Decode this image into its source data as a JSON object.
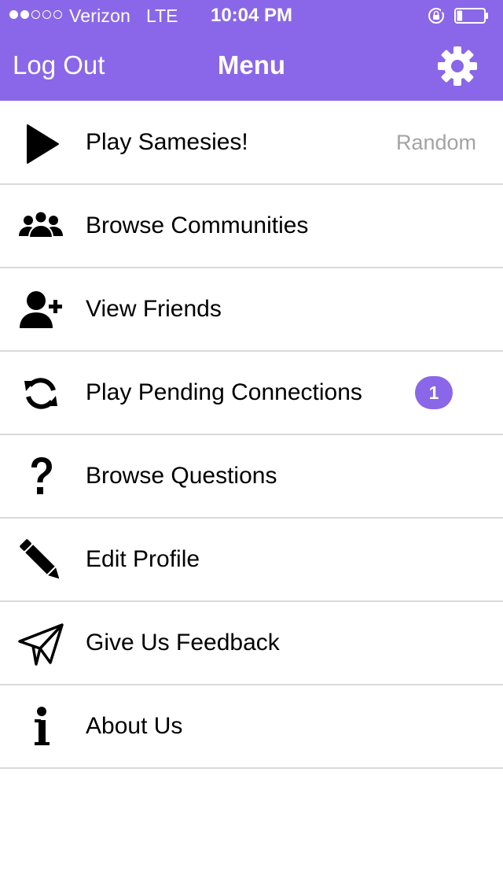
{
  "colors": {
    "accent": "#8a67e8",
    "background": "#ffffff",
    "divider": "#d9d9d9",
    "detail_text": "#a3a3a3"
  },
  "status_bar": {
    "signal_bars_filled": 2,
    "signal_bars_total": 5,
    "carrier": "Verizon",
    "network": "LTE",
    "time": "10:04 PM",
    "battery_level_percent": 20,
    "icons": [
      "rotation-lock-icon",
      "battery-icon"
    ]
  },
  "nav_bar": {
    "left_button": "Log Out",
    "title": "Menu",
    "right_icon": "gear-icon"
  },
  "menu": {
    "items": [
      {
        "label": "Play Samesies!",
        "icon": "play-icon",
        "detail": "Random"
      },
      {
        "label": "Browse Communities",
        "icon": "group-icon"
      },
      {
        "label": "View Friends",
        "icon": "add-friend-icon"
      },
      {
        "label": "Play Pending Connections",
        "icon": "refresh-icon",
        "badge": "1"
      },
      {
        "label": "Browse Questions",
        "icon": "question-icon"
      },
      {
        "label": "Edit Profile",
        "icon": "pencil-icon"
      },
      {
        "label": "Give Us Feedback",
        "icon": "paper-plane-icon"
      },
      {
        "label": "About Us",
        "icon": "info-icon"
      }
    ]
  }
}
